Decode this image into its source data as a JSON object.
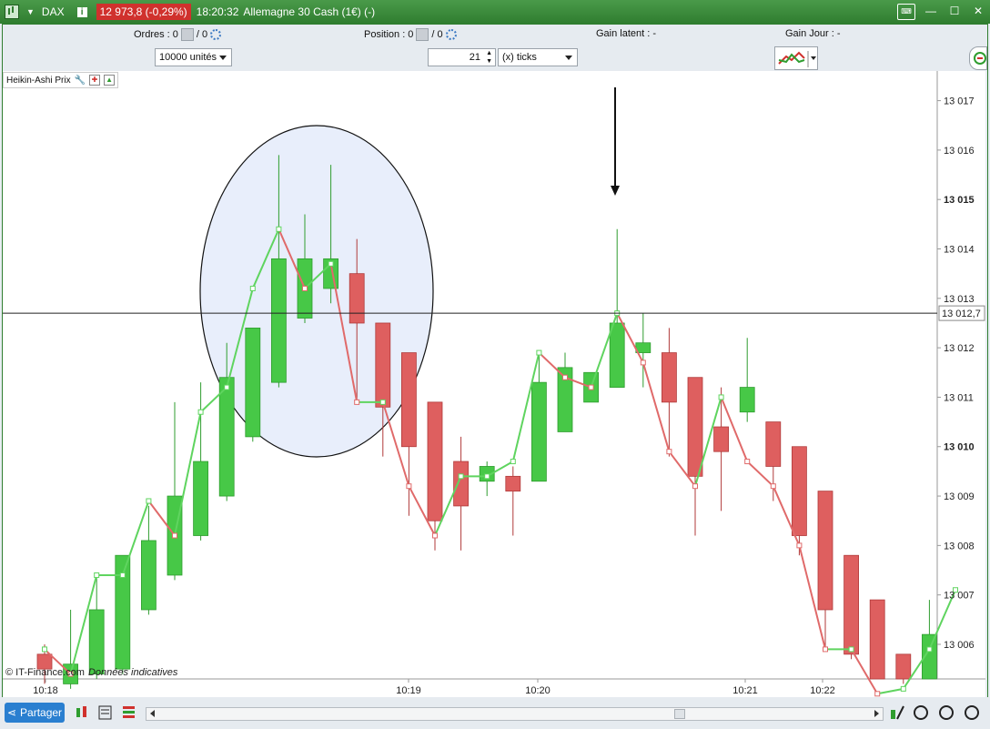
{
  "titlebar": {
    "symbol": "DAX",
    "quote": "12 973,8 (-0,29%)",
    "time": "18:20:32",
    "title": "Allemagne 30 Cash (1€) (-)"
  },
  "toolbar": {
    "orders_label": "Ordres :",
    "orders_value": "0",
    "orders_sep": "/ 0",
    "position_label": "Position :",
    "position_value": "0",
    "position_sep": "/ 0",
    "gain_latent": "Gain latent :  -",
    "gain_jour": "Gain Jour :  -",
    "units": "10000 unités",
    "ticks_value": "21",
    "ticks_unit": "(x) ticks"
  },
  "legend": {
    "label": "Heikin-Ashi Prix"
  },
  "credit": {
    "source": "© IT-Finance.com",
    "note": "Données indicatives"
  },
  "bottombar": {
    "share_label": "Partager"
  },
  "colors": {
    "bull": "#47c847",
    "bear": "#de5f5f",
    "bull_line": "#5fd45f",
    "bear_line": "#e06a6a",
    "highlight_fill": "#e8eefb"
  },
  "chart_data": {
    "type": "candlestick",
    "title": "Heikin-Ashi Prix",
    "x_ticks": [
      "10:18",
      "10:19",
      "10:20",
      "10:21",
      "10:22"
    ],
    "y_ticks": [
      "13 017",
      "13 016",
      "13 015",
      "13 014",
      "13 013",
      "13 012",
      "13 011",
      "13 010",
      "13 009",
      "13 008",
      "13 007",
      "13 006"
    ],
    "y_bold_ticks": [
      "13 015",
      "13 010"
    ],
    "ylim": [
      13005.3,
      13017.6
    ],
    "last_price_label": "13 012,7",
    "last_price": 13012.7,
    "candles": [
      {
        "open": 13005.8,
        "close": 13005.5,
        "high": 13006.0,
        "low": 13005.2
      },
      {
        "open": 13005.2,
        "close": 13005.6,
        "high": 13006.7,
        "low": 13005.1
      },
      {
        "open": 13005.4,
        "close": 13006.7,
        "high": 13007.4,
        "low": 13005.3
      },
      {
        "open": 13005.5,
        "close": 13007.8,
        "high": 13007.8,
        "low": 13005.4
      },
      {
        "open": 13006.7,
        "close": 13008.1,
        "high": 13008.8,
        "low": 13006.6
      },
      {
        "open": 13007.4,
        "close": 13009.0,
        "high": 13010.9,
        "low": 13007.3
      },
      {
        "open": 13008.2,
        "close": 13009.7,
        "high": 13011.3,
        "low": 13008.1
      },
      {
        "open": 13009.0,
        "close": 13011.4,
        "high": 13012.1,
        "low": 13008.9
      },
      {
        "open": 13010.2,
        "close": 13012.4,
        "high": 13012.1,
        "low": 13010.1
      },
      {
        "open": 13011.3,
        "close": 13013.8,
        "high": 13015.9,
        "low": 13011.2
      },
      {
        "open": 13012.6,
        "close": 13013.8,
        "high": 13014.7,
        "low": 13012.5
      },
      {
        "open": 13013.2,
        "close": 13013.8,
        "high": 13015.7,
        "low": 13012.9
      },
      {
        "open": 13013.5,
        "close": 13012.5,
        "high": 13014.2,
        "low": 13010.9
      },
      {
        "open": 13012.5,
        "close": 13010.8,
        "high": 13012.5,
        "low": 13009.8
      },
      {
        "open": 13011.9,
        "close": 13010.0,
        "high": 13011.9,
        "low": 13008.6
      },
      {
        "open": 13010.9,
        "close": 13008.5,
        "high": 13010.9,
        "low": 13007.9
      },
      {
        "open": 13009.7,
        "close": 13008.8,
        "high": 13010.2,
        "low": 13007.9
      },
      {
        "open": 13009.3,
        "close": 13009.6,
        "high": 13009.7,
        "low": 13009.0
      },
      {
        "open": 13009.4,
        "close": 13009.1,
        "high": 13009.6,
        "low": 13008.2
      },
      {
        "open": 13009.3,
        "close": 13011.3,
        "high": 13011.9,
        "low": 13009.3
      },
      {
        "open": 13010.3,
        "close": 13011.6,
        "high": 13011.9,
        "low": 13010.3
      },
      {
        "open": 13010.9,
        "close": 13011.5,
        "high": 13011.5,
        "low": 13010.9
      },
      {
        "open": 13011.2,
        "close": 13012.5,
        "high": 13014.4,
        "low": 13011.2
      },
      {
        "open": 13011.9,
        "close": 13012.1,
        "high": 13012.7,
        "low": 13011.2
      },
      {
        "open": 13011.9,
        "close": 13010.9,
        "high": 13012.4,
        "low": 13009.8
      },
      {
        "open": 13011.4,
        "close": 13009.4,
        "high": 13011.4,
        "low": 13008.2
      },
      {
        "open": 13010.4,
        "close": 13009.9,
        "high": 13011.2,
        "low": 13008.7
      },
      {
        "open": 13010.7,
        "close": 13011.2,
        "high": 13012.2,
        "low": 13010.5
      },
      {
        "open": 13010.5,
        "close": 13009.6,
        "high": 13010.5,
        "low": 13008.9
      },
      {
        "open": 13010.0,
        "close": 13008.2,
        "high": 13010.0,
        "low": 13007.8
      },
      {
        "open": 13009.1,
        "close": 13006.7,
        "high": 13009.1,
        "low": 13005.9
      },
      {
        "open": 13007.8,
        "close": 13005.8,
        "high": 13007.8,
        "low": 13005.7
      },
      {
        "open": 13006.9,
        "close": 13005.3,
        "high": 13006.9,
        "low": 13005.3
      },
      {
        "open": 13005.8,
        "close": 13005.3,
        "high": 13005.8,
        "low": 13005.2
      },
      {
        "open": 13005.3,
        "close": 13006.2,
        "high": 13006.9,
        "low": 13005.3
      }
    ],
    "close_line": [
      13005.9,
      13005.4,
      13007.4,
      13007.4,
      13008.9,
      13008.2,
      13010.7,
      13011.2,
      13013.2,
      13014.4,
      13013.2,
      13013.7,
      13010.9,
      13010.9,
      13009.2,
      13008.2,
      13009.4,
      13009.4,
      13009.7,
      13011.9,
      13011.4,
      13011.2,
      13012.7,
      13011.7,
      13009.9,
      13009.2,
      13011.0,
      13009.7,
      13009.2,
      13008.0,
      13005.9,
      13005.9,
      13005.0,
      13005.1,
      13005.9,
      13007.1
    ],
    "annotations": [
      "ellipse highlight around 10:18 peak",
      "down arrow above spike at ~10:20:20"
    ]
  }
}
